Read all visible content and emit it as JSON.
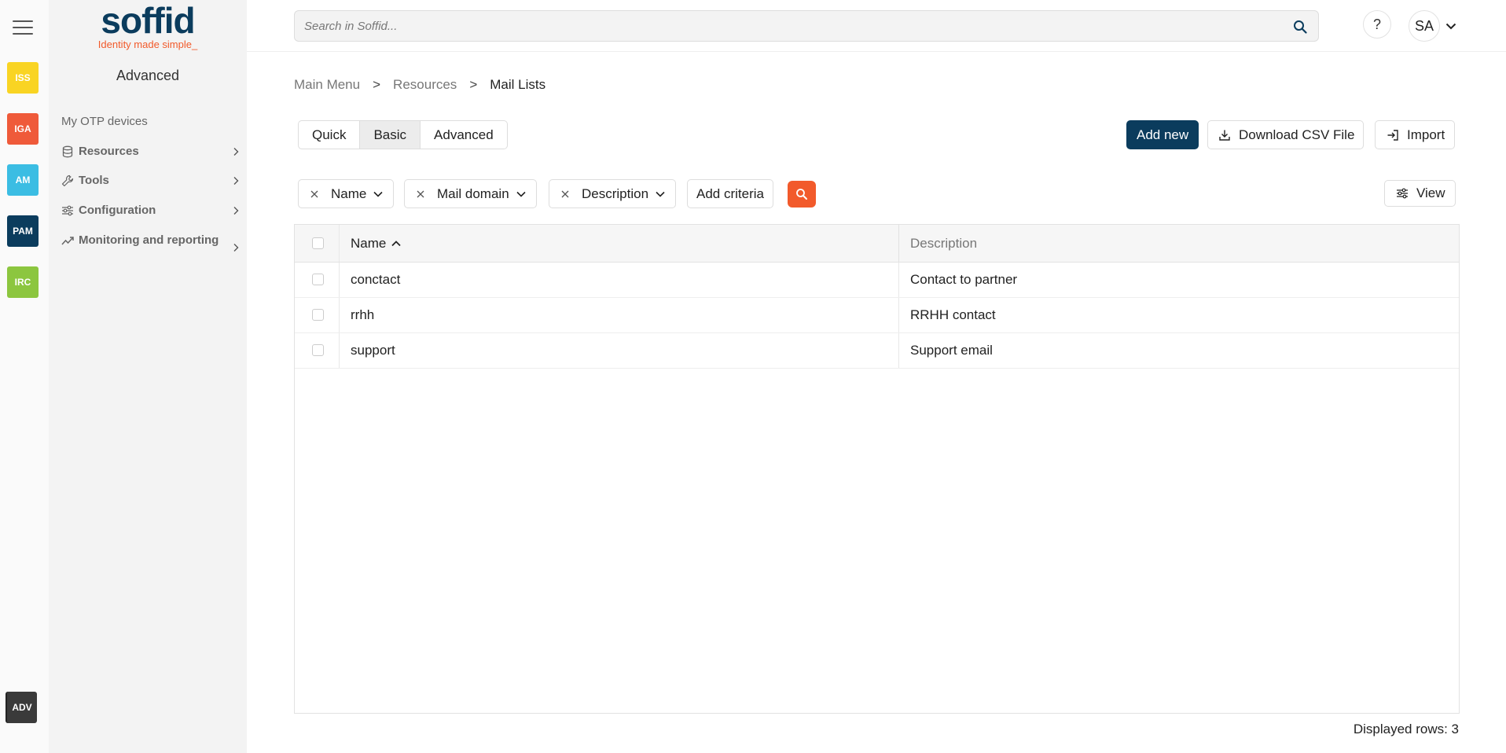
{
  "rail": {
    "modules": [
      {
        "label": "ISS",
        "color": "#f9d423"
      },
      {
        "label": "IGA",
        "color": "#ef5a3a"
      },
      {
        "label": "AM",
        "color": "#3bbde3"
      },
      {
        "label": "PAM",
        "color": "#0b3c5d"
      },
      {
        "label": "IRC",
        "color": "#8cc63f"
      }
    ],
    "active_module": {
      "label": "ADV",
      "color": "#3a3a3a"
    }
  },
  "logo": {
    "wordmark": "soffid",
    "tagline": "Identity made simple_",
    "colors": {
      "primary": "#0b3c5d",
      "accent": "#f25a2b"
    }
  },
  "sidebar": {
    "title": "Advanced",
    "otp_link": "My OTP devices",
    "items": [
      {
        "label": "Resources",
        "icon": "database-icon"
      },
      {
        "label": "Tools",
        "icon": "wrench-icon"
      },
      {
        "label": "Configuration",
        "icon": "sliders-icon"
      },
      {
        "label": "Monitoring and reporting",
        "icon": "trend-icon"
      }
    ]
  },
  "topbar": {
    "search_placeholder": "Search in Soffid...",
    "help_label": "?",
    "user_initials": "SA"
  },
  "breadcrumb": {
    "items": [
      "Main Menu",
      "Resources"
    ],
    "separator": ">",
    "current": "Mail Lists"
  },
  "modes": {
    "options": [
      "Quick",
      "Basic",
      "Advanced"
    ],
    "selected": "Basic"
  },
  "actions": {
    "add_new": "Add new",
    "download_csv": "Download CSV File",
    "import": "Import",
    "view": "View"
  },
  "filters": {
    "chips": [
      "Name",
      "Mail domain",
      "Description"
    ],
    "add_criteria": "Add criteria"
  },
  "table": {
    "columns": [
      "Name",
      "Description"
    ],
    "sorted_by": "Name",
    "sort_direction": "ascending",
    "rows": [
      {
        "name": "conctact",
        "description": "Contact to partner"
      },
      {
        "name": "rrhh",
        "description": "RRHH contact"
      },
      {
        "name": "support",
        "description": "Support email"
      }
    ]
  },
  "footer": {
    "displayed_rows": "Displayed rows: 3"
  }
}
